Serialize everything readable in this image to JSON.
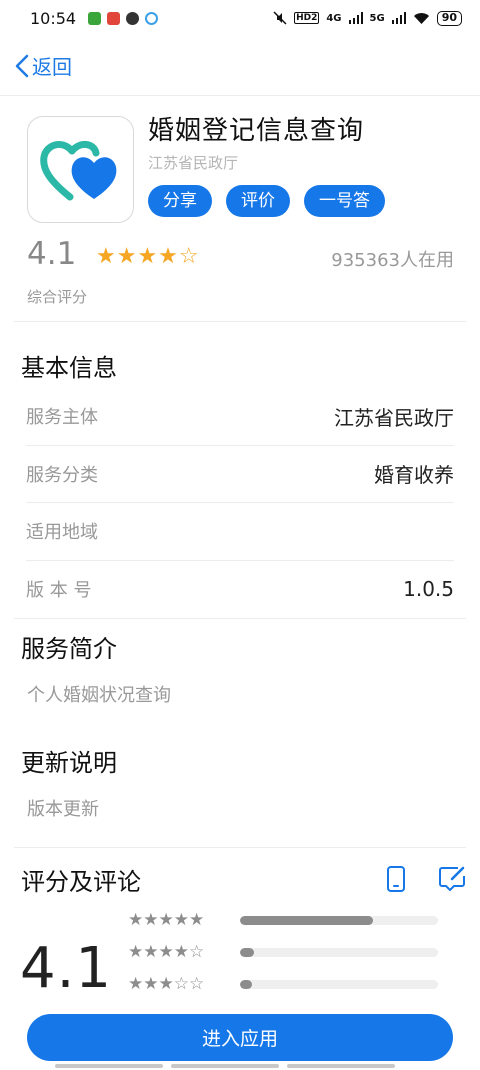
{
  "status_bar": {
    "time": "10:54",
    "network": "4G",
    "network2": "5G",
    "hd": "HD2",
    "battery": "90"
  },
  "nav": {
    "back_label": "返回"
  },
  "app": {
    "title": "婚姻登记信息查询",
    "provider": "江苏省民政厅",
    "actions": [
      "分享",
      "评价",
      "一号答"
    ],
    "icon": "double-heart-icon",
    "accent": "#1677e8",
    "teal": "#2bb8a6"
  },
  "rating_summary": {
    "score": "4.1",
    "stars": "★★★★☆",
    "users": "935363人在用",
    "label": "综合评分"
  },
  "basic_info": {
    "title": "基本信息",
    "rows": [
      {
        "key": "服务主体",
        "value": "江苏省民政厅"
      },
      {
        "key": "服务分类",
        "value": "婚育收养"
      },
      {
        "key": "适用地域",
        "value": ""
      },
      {
        "key": "版 本 号",
        "value": "1.0.5"
      }
    ]
  },
  "intro": {
    "title": "服务简介",
    "text": "个人婚姻状况查询"
  },
  "update": {
    "title": "更新说明",
    "text": "版本更新"
  },
  "reviews": {
    "title": "评分及评论",
    "score": "4.1",
    "distribution": [
      {
        "stars": "★★★★★",
        "fraction": 0.67
      },
      {
        "stars": "★★★★☆",
        "fraction": 0.07
      },
      {
        "stars": "★★★☆☆",
        "fraction": 0.06
      }
    ]
  },
  "bottom": {
    "enter_label": "进入应用"
  }
}
